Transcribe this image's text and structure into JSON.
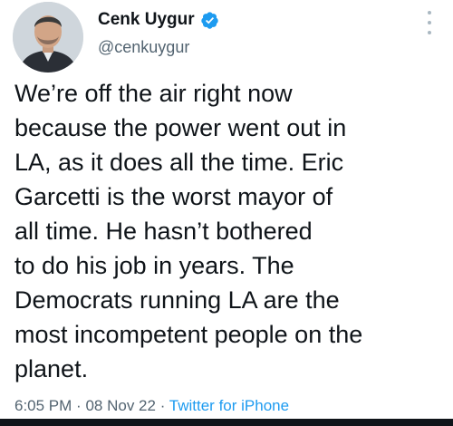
{
  "author": {
    "display_name": "Cenk Uygur",
    "handle": "@cenkuygur",
    "verified": true
  },
  "tweet": {
    "lines": [
      "We’re off the air right now",
      "because the power went out in",
      "LA, as it does all the time. Eric",
      "Garcetti is the worst mayor of",
      "all time. He hasn’t bothered",
      "to do his job in years. The",
      "Democrats running LA are the",
      "most incompetent people on the",
      "planet."
    ],
    "time": "6:05 PM",
    "date": "08 Nov 22",
    "separator": "·",
    "source": "Twitter for iPhone"
  },
  "icons": {
    "verified": "verified-badge-icon",
    "more": "more-options-icon"
  },
  "colors": {
    "text": "#0f1419",
    "secondary": "#536471",
    "accent": "#1d9bf0"
  }
}
